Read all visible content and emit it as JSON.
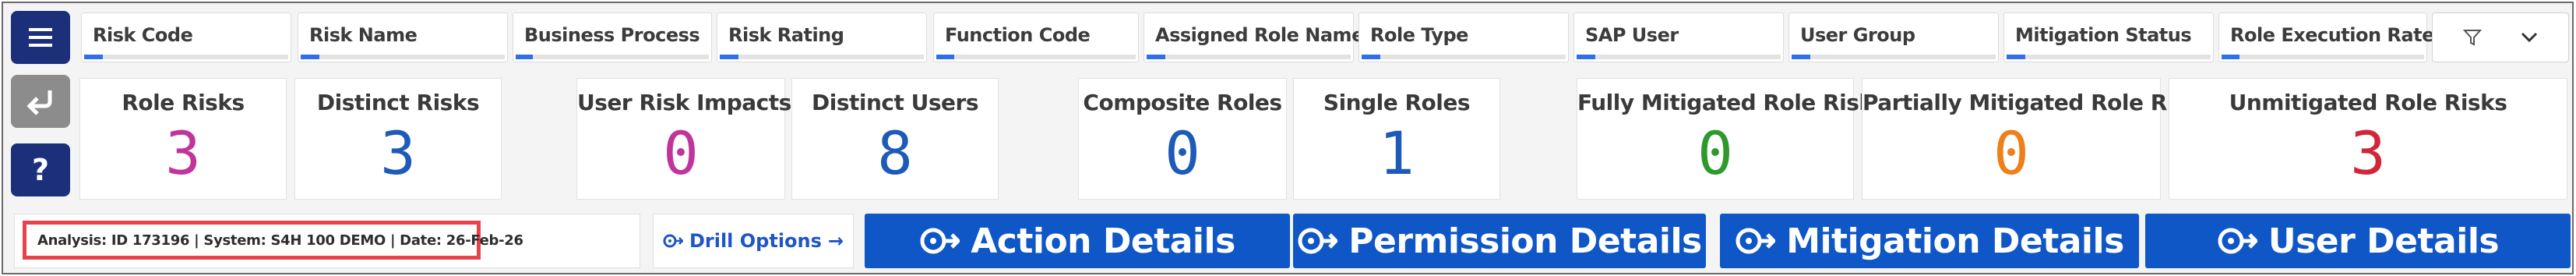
{
  "filters": [
    {
      "label": "Risk Code"
    },
    {
      "label": "Risk Name"
    },
    {
      "label": "Business Process"
    },
    {
      "label": "Risk Rating"
    },
    {
      "label": "Function Code"
    },
    {
      "label": "Assigned Role Name"
    },
    {
      "label": "Role Type"
    },
    {
      "label": "SAP User"
    },
    {
      "label": "User Group"
    },
    {
      "label": "Mitigation Status"
    },
    {
      "label": "Role Execution Rate"
    }
  ],
  "filter_menu": {
    "icons": [
      "filter-icon",
      "chevron-down-icon"
    ]
  },
  "rail": {
    "icons": [
      "hamburger-menu-icon",
      "back-arrow-icon",
      "help-icon"
    ],
    "help_glyph": "?"
  },
  "kpis": [
    {
      "title": "Role Risks",
      "value": "3",
      "color": "#c0359c"
    },
    {
      "title": "Distinct Risks",
      "value": "3",
      "color": "#1e5bb8"
    },
    {
      "title": "User Risk Impacts",
      "value": "0",
      "color": "#c0359c"
    },
    {
      "title": "Distinct Users",
      "value": "8",
      "color": "#1e5bb8"
    },
    {
      "title": "Composite Roles",
      "value": "0",
      "color": "#1e5bb8"
    },
    {
      "title": "Single Roles",
      "value": "1",
      "color": "#1e5bb8"
    },
    {
      "title": "Fully Mitigated Role Risks",
      "value": "0",
      "color": "#2e9a2e"
    },
    {
      "title": "Partially Mitigated Role Risks",
      "value": "0",
      "color": "#ef7f1a"
    },
    {
      "title": "Unmitigated Role Risks",
      "value": "3",
      "color": "#d0273a"
    }
  ],
  "analysis": {
    "text": "Analysis: ID 173196 | System: S4H 100 DEMO | Date: 26-Feb-26"
  },
  "drill": {
    "label": "Drill Options",
    "arrow": "→"
  },
  "actions": [
    {
      "label": "Action Details"
    },
    {
      "label": "Permission Details"
    },
    {
      "label": "Mitigation Details"
    },
    {
      "label": "User Details"
    }
  ],
  "colors": {
    "accent": "#0f56c7",
    "rail_dark": "#1b2f7a",
    "highlight": "#e8434a"
  }
}
